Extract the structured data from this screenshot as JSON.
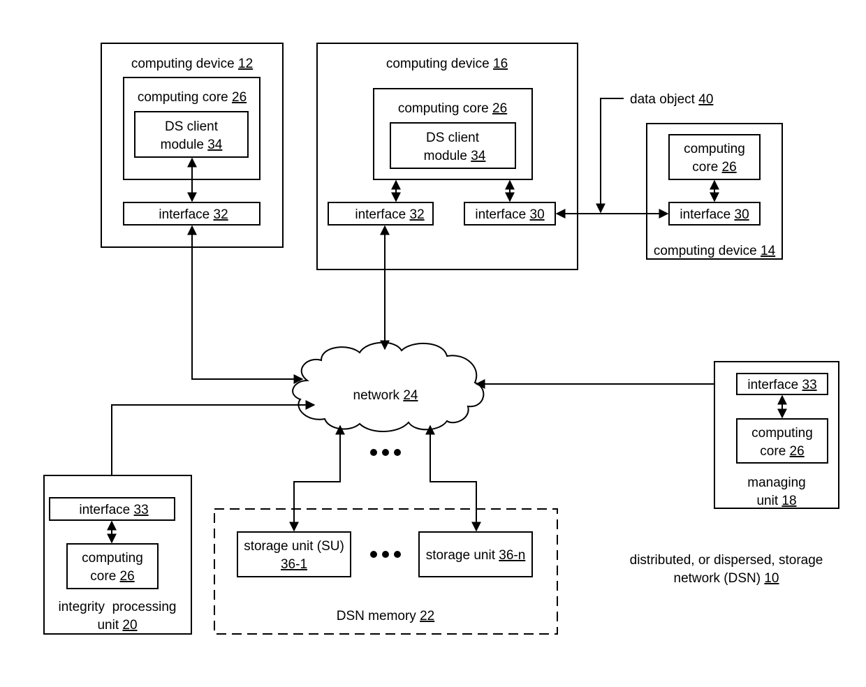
{
  "diagram": {
    "title": "distributed, or dispersed, storage network (DSN)",
    "title_line1": "distributed, or dispersed, storage",
    "title_line2": "network (DSN)",
    "title_ref": "10",
    "computing_device_12": {
      "label": "computing device",
      "ref": "12",
      "core": {
        "label": "computing core",
        "ref": "26"
      },
      "module": {
        "line1": "DS client",
        "line2": "module",
        "ref": "34"
      },
      "interface": {
        "label": "interface",
        "ref": "32"
      }
    },
    "computing_device_16": {
      "label": "computing device",
      "ref": "16",
      "core": {
        "label": "computing core",
        "ref": "26"
      },
      "module": {
        "line1": "DS client",
        "line2": "module",
        "ref": "34"
      },
      "interface_a": {
        "label": "interface",
        "ref": "32"
      },
      "interface_b": {
        "label": "interface",
        "ref": "30"
      }
    },
    "computing_device_14": {
      "label": "computing device",
      "ref": "14",
      "core": {
        "line1": "computing",
        "line2": "core",
        "ref": "26"
      },
      "interface": {
        "label": "interface",
        "ref": "30"
      }
    },
    "data_object": {
      "label": "data object",
      "ref": "40"
    },
    "network": {
      "label": "network",
      "ref": "24"
    },
    "managing_unit": {
      "line1": "managing",
      "line2": "unit",
      "ref": "18",
      "interface": {
        "label": "interface",
        "ref": "33"
      },
      "core": {
        "line1": "computing",
        "line2": "core",
        "ref": "26"
      }
    },
    "integrity_unit": {
      "line1": "integrity  processing",
      "line2": "unit",
      "ref": "20",
      "interface": {
        "label": "interface",
        "ref": "33"
      },
      "core": {
        "line1": "computing",
        "line2": "core",
        "ref": "26"
      }
    },
    "dsn_memory": {
      "label": "DSN memory",
      "ref": "22",
      "su1": {
        "line1": "storage unit (SU)",
        "ref": "36-1"
      },
      "sun": {
        "label": "storage unit",
        "ref": "36-n"
      }
    }
  }
}
